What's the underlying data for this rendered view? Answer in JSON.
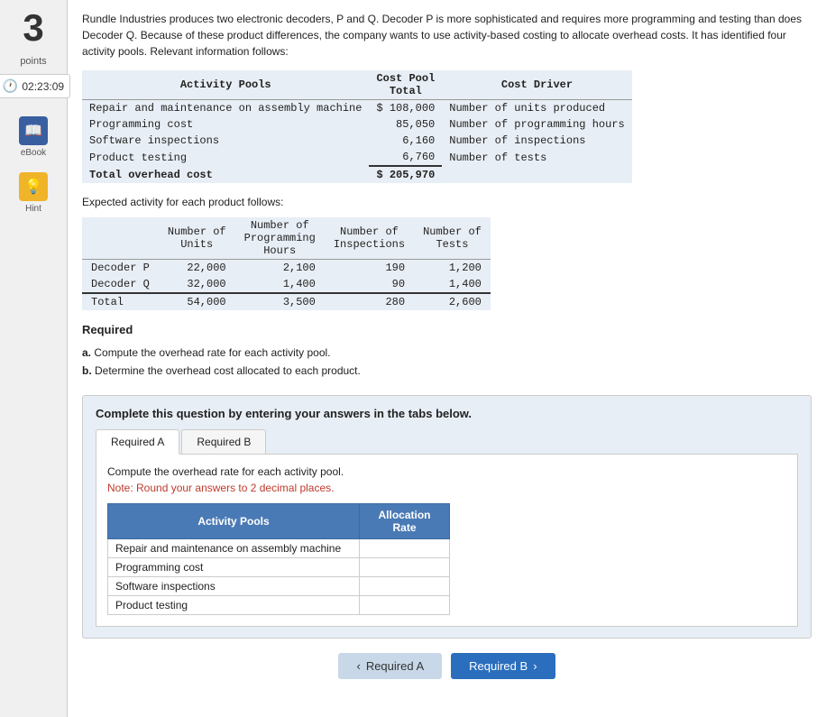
{
  "sidebar": {
    "number": "3",
    "points_label": "points",
    "timer": "02:23:09",
    "ebook_label": "eBook",
    "hint_label": "Hint"
  },
  "question": {
    "text": "Rundle Industries produces two electronic decoders, P and Q. Decoder P is more sophisticated and requires more programming and testing than does Decoder Q. Because of these product differences, the company wants to use activity-based costing to allocate overhead costs. It has identified four activity pools. Relevant information follows:"
  },
  "cost_pool_table": {
    "header_activity": "Activity Pools",
    "header_total": "Cost Pool\nTotal",
    "header_driver": "Cost Driver",
    "rows": [
      {
        "activity": "Repair and maintenance on assembly machine",
        "total": "$ 108,000",
        "driver": "Number of units produced"
      },
      {
        "activity": "Programming cost",
        "total": "85,050",
        "driver": "Number of programming hours"
      },
      {
        "activity": "Software inspections",
        "total": "6,160",
        "driver": "Number of inspections"
      },
      {
        "activity": "Product testing",
        "total": "6,760",
        "driver": "Number of tests"
      }
    ],
    "total_label": "Total overhead cost",
    "total_value": "$ 205,970"
  },
  "expected_activity": {
    "intro": "Expected activity for each product follows:",
    "headers": {
      "blank": "",
      "units": "Number of\nUnits",
      "programming": "Number of\nProgramming\nHours",
      "inspections": "Number of\nInspections",
      "tests": "Number of\nTests"
    },
    "rows": [
      {
        "label": "Decoder P",
        "units": "22,000",
        "programming": "2,100",
        "inspections": "190",
        "tests": "1,200"
      },
      {
        "label": "Decoder Q",
        "units": "32,000",
        "programming": "1,400",
        "inspections": "90",
        "tests": "1,400"
      }
    ],
    "total_label": "Total",
    "totals": {
      "units": "54,000",
      "programming": "3,500",
      "inspections": "280",
      "tests": "2,600"
    }
  },
  "required": {
    "heading": "Required",
    "items": [
      {
        "letter": "a.",
        "text": "Compute the overhead rate for each activity pool."
      },
      {
        "letter": "b.",
        "text": "Determine the overhead cost allocated to each product."
      }
    ]
  },
  "complete_box": {
    "title": "Complete this question by entering your answers in the tabs below."
  },
  "tabs": [
    {
      "label": "Required A",
      "active": true
    },
    {
      "label": "Required B",
      "active": false
    }
  ],
  "required_a": {
    "instruction": "Compute the overhead rate for each activity pool.",
    "note": "Note: Round your answers to 2 decimal places.",
    "table_headers": {
      "activity": "Activity Pools",
      "rate": "Allocation\nRate"
    },
    "rows": [
      {
        "label": "Repair and maintenance on assembly machine",
        "value": ""
      },
      {
        "label": "Programming cost",
        "value": ""
      },
      {
        "label": "Software inspections",
        "value": ""
      },
      {
        "label": "Product testing",
        "value": ""
      }
    ]
  },
  "nav": {
    "prev_label": "< Required A",
    "next_label": "Required B >"
  }
}
